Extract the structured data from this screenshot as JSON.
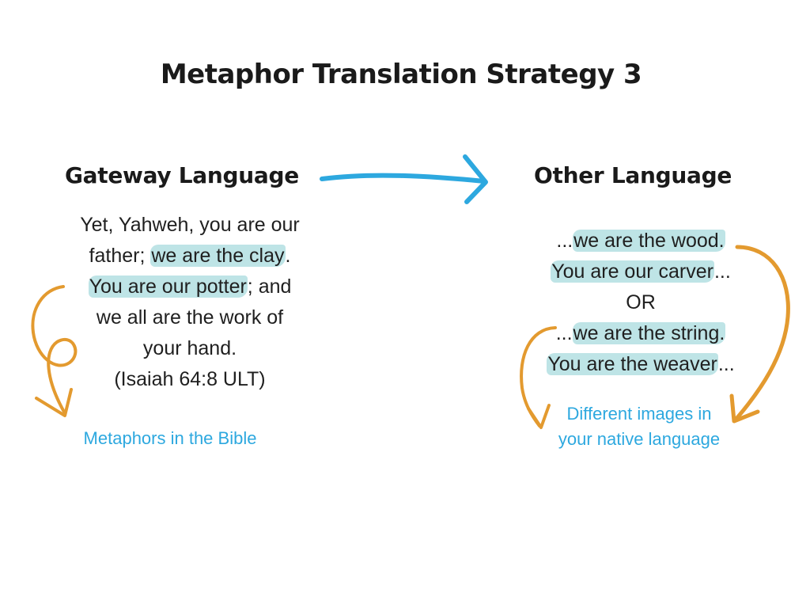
{
  "title": "Metaphor Translation Strategy 3",
  "gateway": {
    "heading": "Gateway Language",
    "verse_l1": "Yet, Yahweh, you are our",
    "verse_l2a": "father; ",
    "verse_l2_hl": "we are the clay",
    "verse_l2b": ".",
    "verse_l3_hl": "You are our potter",
    "verse_l3b": "; and",
    "verse_l4": "we all are the work of",
    "verse_l5": "your hand.",
    "reference": "(Isaiah 64:8 ULT)",
    "caption": "Metaphors in the Bible"
  },
  "other": {
    "heading": "Other Language",
    "l1a": "...",
    "l1_hl": "we are the wood.",
    "l2_hl": "You are our carver",
    "l2b": "...",
    "or": "OR",
    "l3a": "...",
    "l3_hl": "we are the string.",
    "l4_hl": "You are the weaver",
    "l4b": "...",
    "caption_l1": "Different images in",
    "caption_l2": "your native language"
  },
  "colors": {
    "arrow_blue": "#2da8df",
    "arrow_orange": "#e39a2f",
    "highlight": "#6fc4c7"
  }
}
